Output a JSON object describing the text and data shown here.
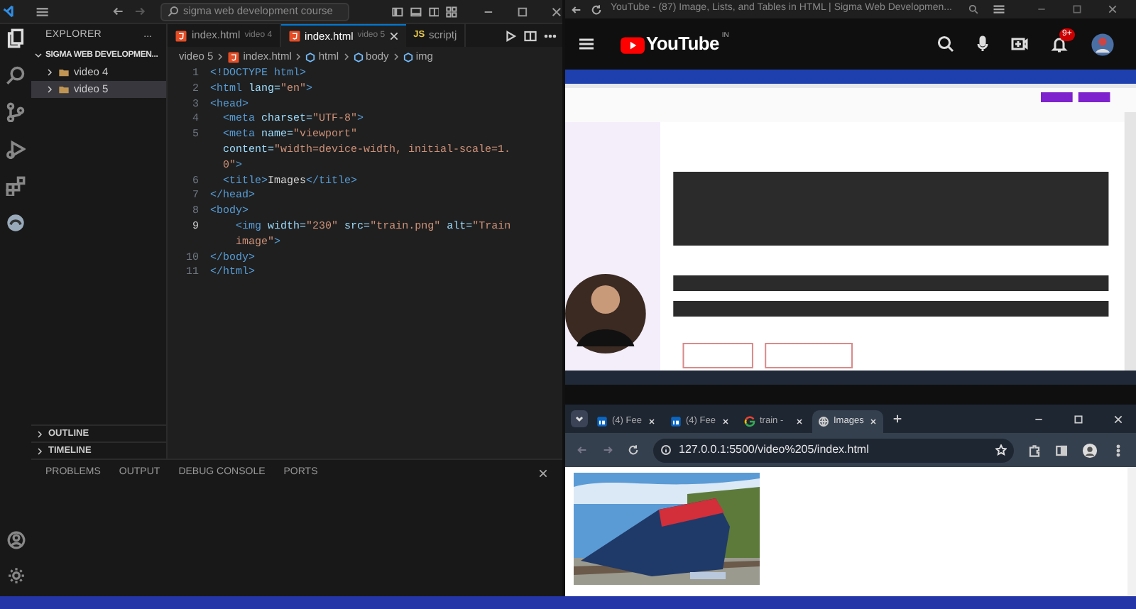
{
  "vscode": {
    "search": "sigma web development course",
    "explorer": {
      "title": "EXPLORER",
      "more": "...",
      "root": {
        "label": "SIGMA WEB DEVELOPMEN...",
        "expanded": true,
        "children": [
          {
            "label": "video 4",
            "expanded": false,
            "selected": false
          },
          {
            "label": "video 5",
            "expanded": false,
            "selected": true
          }
        ]
      }
    },
    "sections": [
      {
        "label": "OUTLINE",
        "expanded": false
      },
      {
        "label": "TIMELINE",
        "expanded": false
      }
    ],
    "tabs": [
      {
        "kind": "html",
        "label": "index.html",
        "description": "video 4",
        "selected": false
      },
      {
        "kind": "html",
        "label": "index.html",
        "description": "video 5",
        "selected": true
      },
      {
        "kind": "js",
        "icon_text": "JS",
        "label": "scriptj",
        "selected": false
      }
    ],
    "breadcrumb": [
      {
        "kind": "folder",
        "label": "video 5"
      },
      {
        "kind": "html",
        "label": "index.html"
      },
      {
        "kind": "symbol",
        "label": "html"
      },
      {
        "kind": "symbol",
        "label": "body"
      },
      {
        "kind": "symbol",
        "label": "img"
      }
    ],
    "code": [
      {
        "number": "1",
        "current": false,
        "rows": [
          {
            "segments": [
              {
                "kind": "tag",
                "text": "<!DOCTYPE html>"
              }
            ]
          }
        ]
      },
      {
        "number": "2",
        "current": false,
        "rows": [
          {
            "segments": [
              {
                "kind": "tag",
                "text": "<html"
              },
              {
                "kind": "attr",
                "text": " lang="
              },
              {
                "kind": "str",
                "text": "\"en\""
              },
              {
                "kind": "tag",
                "text": ">"
              }
            ]
          }
        ]
      },
      {
        "number": "3",
        "current": false,
        "rows": [
          {
            "segments": [
              {
                "kind": "tag",
                "text": "<head>"
              }
            ]
          }
        ]
      },
      {
        "number": "4",
        "current": false,
        "rows": [
          {
            "segments": [
              {
                "kind": "tag",
                "text": "  <meta"
              },
              {
                "kind": "attr",
                "text": " charset="
              },
              {
                "kind": "str",
                "text": "\"UTF-8\""
              },
              {
                "kind": "tag",
                "text": ">"
              }
            ]
          }
        ]
      },
      {
        "number": "5",
        "current": false,
        "rows": [
          {
            "segments": [
              {
                "kind": "tag",
                "text": "  <meta"
              },
              {
                "kind": "attr",
                "text": " name="
              },
              {
                "kind": "str",
                "text": "\"viewport\""
              }
            ]
          },
          {
            "segments": [
              {
                "kind": "attr",
                "text": "  content="
              },
              {
                "kind": "str",
                "text": "\"width=device-width, initial-scale=1."
              }
            ]
          },
          {
            "segments": [
              {
                "kind": "str",
                "text": "  0\""
              },
              {
                "kind": "tag",
                "text": ">"
              }
            ]
          }
        ]
      },
      {
        "number": "6",
        "current": false,
        "rows": [
          {
            "segments": [
              {
                "kind": "tag",
                "text": "  <title>"
              },
              {
                "kind": "text",
                "text": "Images"
              },
              {
                "kind": "tag",
                "text": "</title>"
              }
            ]
          }
        ]
      },
      {
        "number": "7",
        "current": false,
        "rows": [
          {
            "segments": [
              {
                "kind": "tag",
                "text": "</head>"
              }
            ]
          }
        ]
      },
      {
        "number": "8",
        "current": false,
        "rows": [
          {
            "segments": [
              {
                "kind": "tag",
                "text": "<body>"
              }
            ]
          }
        ]
      },
      {
        "number": "9",
        "current": true,
        "rows": [
          {
            "segments": [
              {
                "kind": "tag",
                "text": "    <img"
              },
              {
                "kind": "attr",
                "text": " width="
              },
              {
                "kind": "str",
                "text": "\"230\""
              },
              {
                "kind": "attr",
                "text": " src="
              },
              {
                "kind": "str",
                "text": "\"train.png\""
              },
              {
                "kind": "attr",
                "text": " alt="
              },
              {
                "kind": "str",
                "text": "\"Train"
              }
            ]
          },
          {
            "segments": [
              {
                "kind": "str",
                "text": "    image\""
              },
              {
                "kind": "tag",
                "text": ">"
              }
            ]
          }
        ]
      },
      {
        "number": "10",
        "current": false,
        "rows": [
          {
            "segments": [
              {
                "kind": "tag",
                "text": "</body>"
              }
            ]
          }
        ]
      },
      {
        "number": "11",
        "current": false,
        "rows": [
          {
            "segments": [
              {
                "kind": "tag",
                "text": "</html>"
              }
            ]
          }
        ]
      }
    ],
    "panel_tabs": [
      "PROBLEMS",
      "OUTPUT",
      "DEBUG CONSOLE",
      "PORTS"
    ]
  },
  "youtube_window": {
    "title": "YouTube - (87) Image, Lists, and Tables in HTML | Sigma Web Developmen...",
    "logo": "YouTube",
    "region": "IN",
    "notifications": "9+"
  },
  "browser": {
    "tabs": [
      {
        "kind": "app",
        "label": "(4) Fee",
        "selected": false
      },
      {
        "kind": "app",
        "label": "(4) Fee",
        "selected": false
      },
      {
        "kind": "ring",
        "label": "train -",
        "selected": false
      },
      {
        "kind": "globe",
        "label": "Images",
        "selected": true
      }
    ],
    "url": "127.0.0.1:5500/video%205/index.html"
  }
}
